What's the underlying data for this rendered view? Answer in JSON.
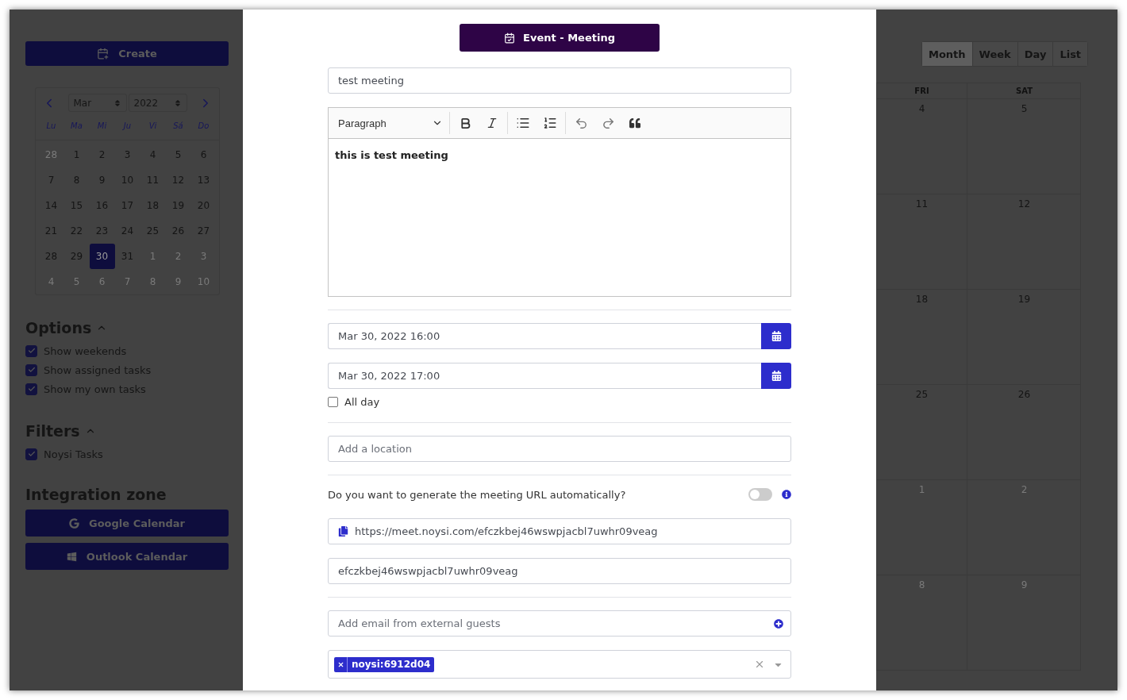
{
  "sidebar": {
    "create_button": "Create",
    "mini_calendar": {
      "month": "Mar",
      "year": "2022",
      "weekdays": [
        "Lu",
        "Ma",
        "Mi",
        "Ju",
        "Vi",
        "Sá",
        "Do"
      ],
      "weeks": [
        [
          {
            "day": "28",
            "muted": true,
            "selected": false
          },
          {
            "day": "1",
            "muted": false,
            "selected": false
          },
          {
            "day": "2",
            "muted": false,
            "selected": false
          },
          {
            "day": "3",
            "muted": false,
            "selected": false
          },
          {
            "day": "4",
            "muted": false,
            "selected": false
          },
          {
            "day": "5",
            "muted": false,
            "selected": false
          },
          {
            "day": "6",
            "muted": false,
            "selected": false
          }
        ],
        [
          {
            "day": "7",
            "muted": false,
            "selected": false
          },
          {
            "day": "8",
            "muted": false,
            "selected": false
          },
          {
            "day": "9",
            "muted": false,
            "selected": false
          },
          {
            "day": "10",
            "muted": false,
            "selected": false
          },
          {
            "day": "11",
            "muted": false,
            "selected": false
          },
          {
            "day": "12",
            "muted": false,
            "selected": false
          },
          {
            "day": "13",
            "muted": false,
            "selected": false
          }
        ],
        [
          {
            "day": "14",
            "muted": false,
            "selected": false
          },
          {
            "day": "15",
            "muted": false,
            "selected": false
          },
          {
            "day": "16",
            "muted": false,
            "selected": false
          },
          {
            "day": "17",
            "muted": false,
            "selected": false
          },
          {
            "day": "18",
            "muted": false,
            "selected": false
          },
          {
            "day": "19",
            "muted": false,
            "selected": false
          },
          {
            "day": "20",
            "muted": false,
            "selected": false
          }
        ],
        [
          {
            "day": "21",
            "muted": false,
            "selected": false
          },
          {
            "day": "22",
            "muted": false,
            "selected": false
          },
          {
            "day": "23",
            "muted": false,
            "selected": false
          },
          {
            "day": "24",
            "muted": false,
            "selected": false
          },
          {
            "day": "25",
            "muted": false,
            "selected": false
          },
          {
            "day": "26",
            "muted": false,
            "selected": false
          },
          {
            "day": "27",
            "muted": false,
            "selected": false
          }
        ],
        [
          {
            "day": "28",
            "muted": false,
            "selected": false
          },
          {
            "day": "29",
            "muted": false,
            "selected": false
          },
          {
            "day": "30",
            "muted": false,
            "selected": true
          },
          {
            "day": "31",
            "muted": false,
            "selected": false
          },
          {
            "day": "1",
            "muted": true,
            "selected": false
          },
          {
            "day": "2",
            "muted": true,
            "selected": false
          },
          {
            "day": "3",
            "muted": true,
            "selected": false
          }
        ],
        [
          {
            "day": "4",
            "muted": true,
            "selected": false
          },
          {
            "day": "5",
            "muted": true,
            "selected": false
          },
          {
            "day": "6",
            "muted": true,
            "selected": false
          },
          {
            "day": "7",
            "muted": true,
            "selected": false
          },
          {
            "day": "8",
            "muted": true,
            "selected": false
          },
          {
            "day": "9",
            "muted": true,
            "selected": false
          },
          {
            "day": "10",
            "muted": true,
            "selected": false
          }
        ]
      ]
    },
    "sections": [
      {
        "title": "Options",
        "expanded": true,
        "items": [
          {
            "label": "Show weekends",
            "checked": true
          },
          {
            "label": "Show assigned tasks",
            "checked": true
          },
          {
            "label": "Show my own tasks",
            "checked": true
          }
        ]
      },
      {
        "title": "Filters",
        "expanded": true,
        "items": [
          {
            "label": "Noysi Tasks",
            "checked": true
          }
        ]
      }
    ],
    "integration": {
      "title": "Integration zone",
      "buttons": [
        {
          "label": "Google Calendar",
          "kind": "google"
        },
        {
          "label": "Outlook Calendar",
          "kind": "windows"
        }
      ]
    }
  },
  "modal": {
    "header": "Event - Meeting",
    "title_value": "test meeting",
    "editor": {
      "block_type": "Paragraph",
      "content": "this is test meeting"
    },
    "start": "Mar 30, 2022 16:00",
    "end": "Mar 30, 2022 17:00",
    "all_day": {
      "label": "All day",
      "checked": false
    },
    "location_placeholder": "Add a location",
    "auto_url": {
      "question": "Do you want to generate the meeting URL automatically?",
      "on": false
    },
    "meeting_url": "https://meet.noysi.com/efczkbej46wswpjacbl7uwhr09veag",
    "meeting_code": "efczkbej46wswpjacbl7uwhr09veag",
    "guests_placeholder": "Add email from external guests",
    "participants": [
      {
        "label": "noysi:6912d04"
      }
    ]
  },
  "calendar": {
    "views": [
      {
        "label": "Month",
        "selected": true
      },
      {
        "label": "Week",
        "selected": false
      },
      {
        "label": "Day",
        "selected": false
      },
      {
        "label": "List",
        "selected": false
      }
    ],
    "weekdays": [
      "FRI",
      "SAT"
    ],
    "weeks": [
      [
        {
          "day": "4",
          "muted": false
        },
        {
          "day": "5",
          "muted": false
        }
      ],
      [
        {
          "day": "11",
          "muted": false
        },
        {
          "day": "12",
          "muted": false
        }
      ],
      [
        {
          "day": "18",
          "muted": false
        },
        {
          "day": "19",
          "muted": false
        }
      ],
      [
        {
          "day": "25",
          "muted": false
        },
        {
          "day": "26",
          "muted": false
        }
      ],
      [
        {
          "day": "1",
          "muted": true
        },
        {
          "day": "2",
          "muted": true
        }
      ],
      [
        {
          "day": "8",
          "muted": true
        },
        {
          "day": "9",
          "muted": true
        }
      ]
    ]
  }
}
